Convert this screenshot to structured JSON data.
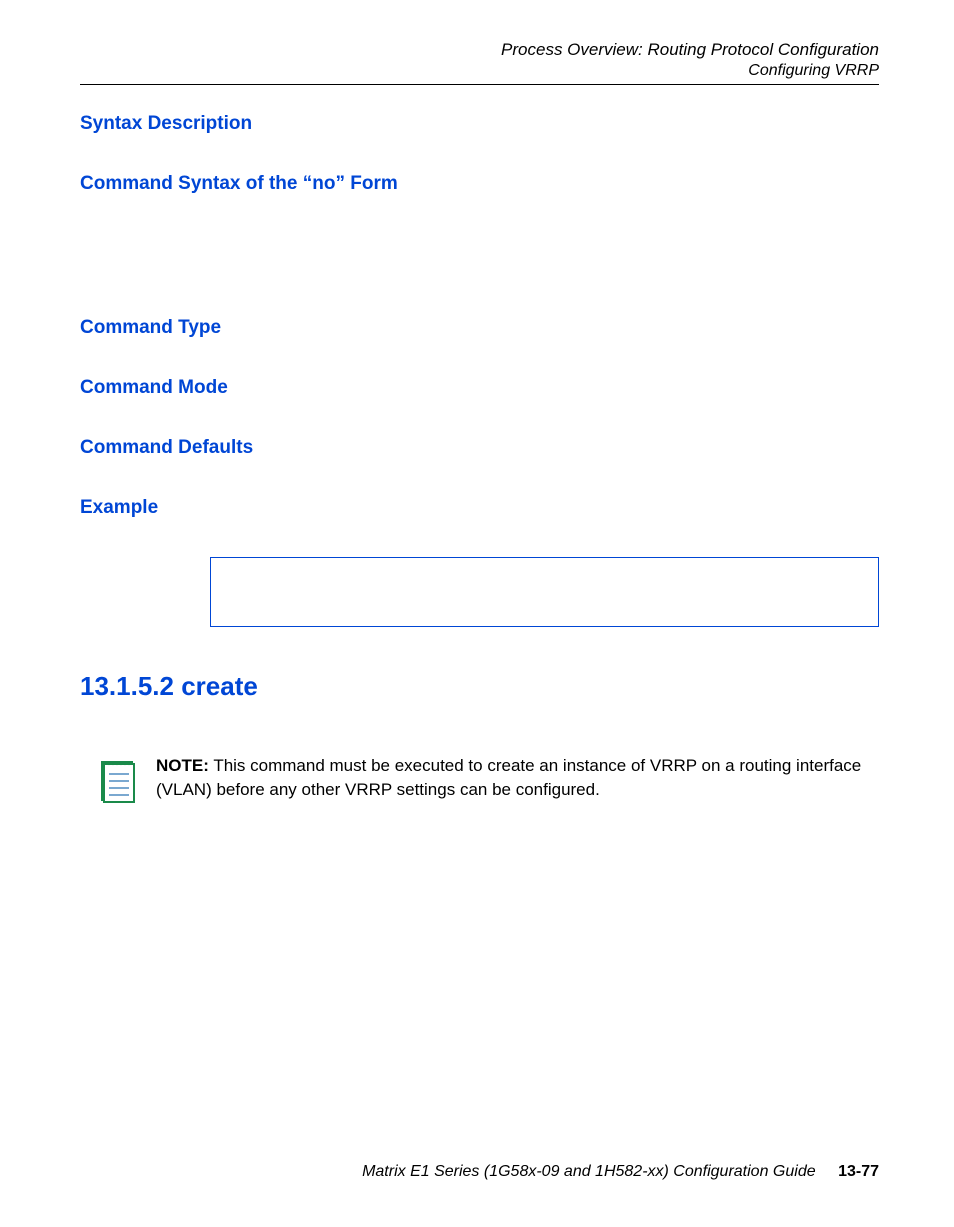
{
  "header": {
    "line1": "Process Overview: Routing Protocol Configuration",
    "line2": "Configuring VRRP"
  },
  "sections": {
    "syntax_description": "Syntax Description",
    "command_syntax_no": "Command Syntax of the “no” Form",
    "command_type": "Command Type",
    "command_mode": "Command Mode",
    "command_defaults": "Command Defaults",
    "example": "Example",
    "create_section": "13.1.5.2  create"
  },
  "note": {
    "label": "NOTE:",
    "text": "This command must be executed to create an instance of VRRP on a routing interface (VLAN) before any other VRRP settings can be configured."
  },
  "footer": {
    "guide": "Matrix E1 Series (1G58x-09 and 1H582-xx) Configuration Guide",
    "page": "13-77"
  }
}
